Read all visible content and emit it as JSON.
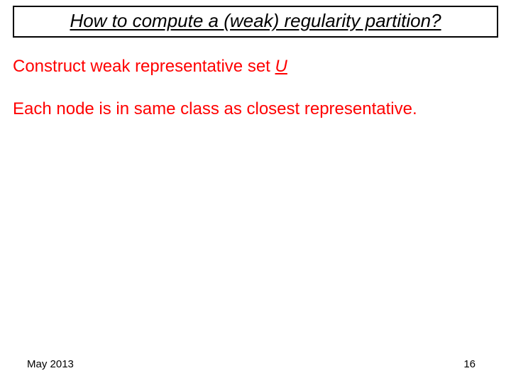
{
  "title": "How to compute a (weak) regularity partition?",
  "line1_pre": "Construct weak representative set ",
  "line1_var": "U",
  "line2": "Each node is in same class as closest representative.",
  "footer": {
    "date": "May 2013",
    "page": "16"
  }
}
